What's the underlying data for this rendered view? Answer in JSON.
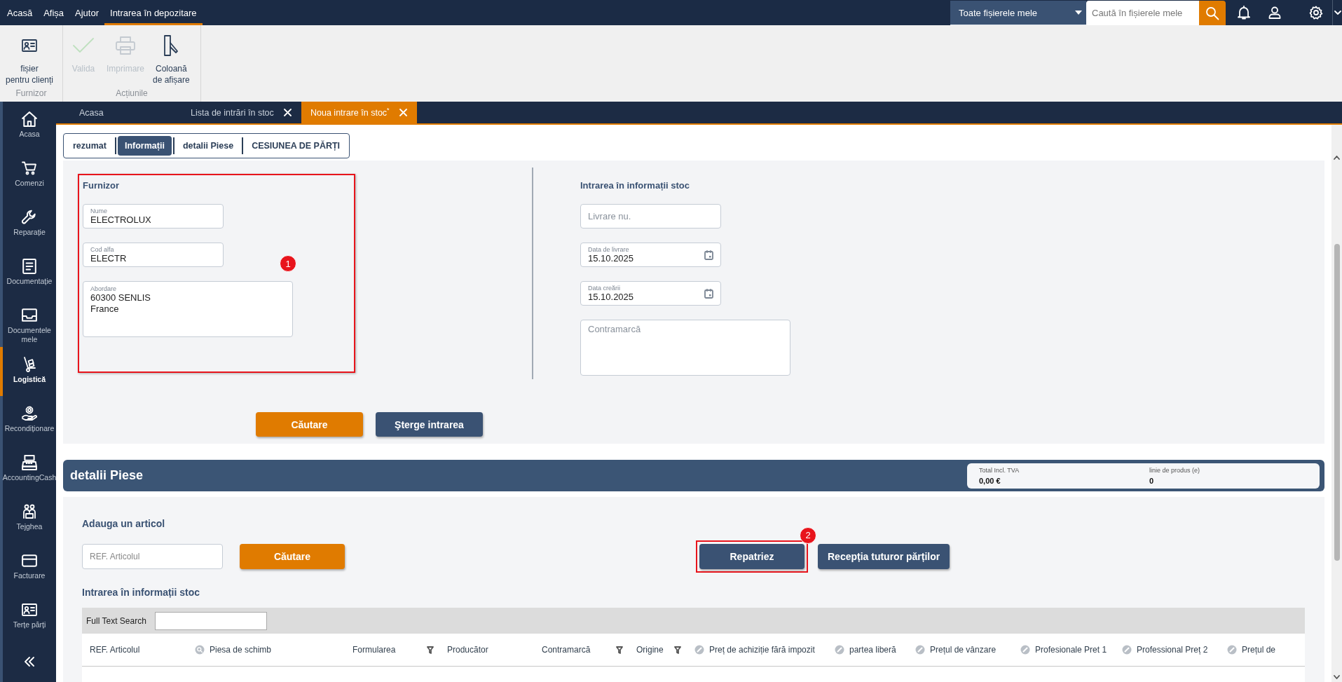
{
  "top_menu": [
    {
      "label": "Acasă",
      "selected": false
    },
    {
      "label": "Afișa",
      "selected": false
    },
    {
      "label": "Ajutor",
      "selected": false
    },
    {
      "label": "Intrarea în depozitare",
      "selected": true
    }
  ],
  "file_filter": {
    "value": "Toate fișierele mele"
  },
  "search": {
    "placeholder": "Caută în fișierele mele"
  },
  "ribbon": {
    "groups": [
      {
        "label": "Furnizor",
        "buttons": [
          {
            "label": "fișier\npentru clienți",
            "disabled": false
          }
        ]
      },
      {
        "label": "Acțiunile",
        "buttons": [
          {
            "label": "Valida",
            "disabled": true
          },
          {
            "label": "Imprimare",
            "disabled": true
          },
          {
            "label": "Coloană\nde afișare",
            "disabled": false
          }
        ]
      }
    ]
  },
  "sidebar": {
    "items": [
      {
        "label": "Acasa",
        "selected": false
      },
      {
        "label": "Comenzi",
        "selected": false
      },
      {
        "label": "Reparație",
        "selected": false
      },
      {
        "label": "Documentație",
        "selected": false
      },
      {
        "label": "Documentele\nmele",
        "selected": false
      },
      {
        "label": "Logistică",
        "selected": true
      },
      {
        "label": "Recondiționare",
        "selected": false
      },
      {
        "label": "AccountingCash",
        "selected": false
      },
      {
        "label": "Tejghea",
        "selected": false
      },
      {
        "label": "Facturare",
        "selected": false
      },
      {
        "label": "Terțe părți",
        "selected": false
      }
    ]
  },
  "doc_tabs": [
    {
      "label": "Acasa",
      "selected": false,
      "closable": false
    },
    {
      "label": "Lista de intrări în stoc",
      "selected": false,
      "closable": true
    },
    {
      "label": "Noua intrare în stoc$^{*}$",
      "selected": true,
      "closable": true
    }
  ],
  "section_tabs": [
    {
      "label": "rezumat",
      "selected": false
    },
    {
      "label": "Informații",
      "selected": true
    },
    {
      "label": "detalii Piese",
      "selected": false
    },
    {
      "label": "CESIUNEA DE PĂRȚI",
      "selected": false
    }
  ],
  "supplier": {
    "title": "Furnizor",
    "highlighted": true,
    "badge": "1",
    "fields": [
      {
        "kind": "text",
        "label": "Nume",
        "value": "ELECTROLUX"
      },
      {
        "kind": "text",
        "label": "Cod alfa",
        "value": "ELECTR"
      },
      {
        "kind": "textarea",
        "label": "Abordare",
        "value": "60300 SENLIS\nFrance"
      }
    ]
  },
  "entry_info": {
    "title": "Intrarea în informații stoc",
    "fields": [
      {
        "kind": "text",
        "placeholder": "Livrare nu."
      },
      {
        "kind": "date",
        "label": "Data de livrare",
        "value": "15.10.2025"
      },
      {
        "kind": "date",
        "label": "Data creării",
        "value": "15.10.2025"
      },
      {
        "kind": "textarea",
        "placeholder": "Contramarcă"
      }
    ]
  },
  "form_actions": [
    {
      "label": "Căutare",
      "kind": "primary"
    },
    {
      "label": "Şterge intrarea",
      "kind": "secondary"
    }
  ],
  "parts": {
    "title": "detalii Piese",
    "summary": [
      {
        "label": "Total Incl. TVA",
        "value": "0,00 €"
      },
      {
        "label": "linie de produs (e)",
        "value": "0"
      }
    ],
    "add_title": "Adauga un articol",
    "ref_field": {
      "placeholder": "REF. Articolul"
    },
    "search_button": {
      "label": "Căutare"
    },
    "actions": [
      {
        "label": "Repatriez",
        "highlighted": true,
        "badge": "2"
      },
      {
        "label": "Recepția tuturor părților",
        "highlighted": false
      }
    ],
    "grid": {
      "title": "Intrarea în informații stoc",
      "search_label": "Full Text Search",
      "columns": [
        {
          "label": "REF. Articolul",
          "kind": "plain",
          "filterable": false
        },
        {
          "label": "Piesa de schimb",
          "kind": "lookup",
          "filterable": false
        },
        {
          "label": "Formularea",
          "kind": "plain",
          "filterable": true
        },
        {
          "label": "Producător",
          "kind": "plain",
          "filterable": false
        },
        {
          "label": "Contramarcă",
          "kind": "plain",
          "filterable": true
        },
        {
          "label": "Origine",
          "kind": "plain",
          "filterable": true
        },
        {
          "label": "Preț de achiziție fără impozit",
          "kind": "editable",
          "filterable": false
        },
        {
          "label": "partea liberă",
          "kind": "editable",
          "filterable": false
        },
        {
          "label": "Prețul de vânzare",
          "kind": "editable",
          "filterable": false
        },
        {
          "label": "Profesionale Pret 1",
          "kind": "editable",
          "filterable": false
        },
        {
          "label": "Professional Preț 2",
          "kind": "editable",
          "filterable": false
        },
        {
          "label": "Prețul de",
          "kind": "editable",
          "filterable": false
        }
      ]
    }
  }
}
